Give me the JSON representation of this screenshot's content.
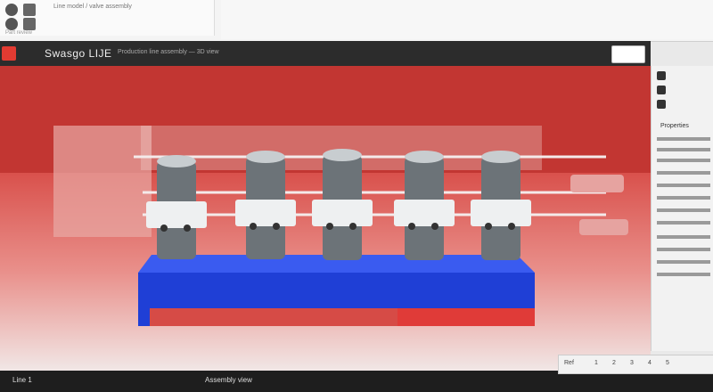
{
  "app": {
    "title": "Swasgo LIJE",
    "subtitle": "Production line assembly — 3D view"
  },
  "topbar": {
    "text": "Line model / valve assembly",
    "meta": "Part review"
  },
  "panel": {
    "heading": "Properties"
  },
  "status": {
    "left": "Line 1",
    "middle": "Assembly view",
    "right_items": [
      "Ref",
      "1",
      "2",
      "3",
      "4",
      "5"
    ]
  },
  "colors": {
    "accent": "#e23b32",
    "floor_red": "#d9514c",
    "plate_blue": "#1f3fd6"
  }
}
